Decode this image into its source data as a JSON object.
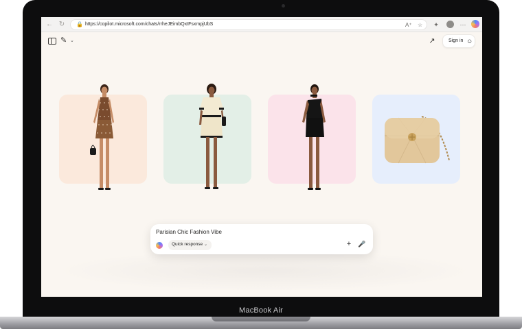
{
  "browser": {
    "url": "https://copilot.microsoft.com/chats/rrheJEimbQxtFsxmpjUbS",
    "icons": [
      "back-icon",
      "refresh-icon",
      "lock-icon",
      "read-aloud-icon",
      "favorite-star-icon",
      "favorites-icon",
      "profile-icon",
      "more-icon",
      "copilot-icon"
    ]
  },
  "header": {
    "sign_in_label": "Sign in"
  },
  "products": [
    {
      "name": "houndstooth halter mini dress",
      "bg": "#fbe9dc"
    },
    {
      "name": "cream tweed mini dress",
      "bg": "#e3efe7"
    },
    {
      "name": "black asymmetric mini dress",
      "bg": "#fbe3ea"
    },
    {
      "name": "beige quilted shoulder bag",
      "bg": "#e6eefc"
    }
  ],
  "chat": {
    "prompt_text": "Parisian Chic Fashion Vibe",
    "mode_label": "Quick response"
  },
  "device": {
    "label": "MacBook Air"
  },
  "colors": {
    "page_bg": "#faf6f1",
    "bag_color": "#e2c79b"
  }
}
